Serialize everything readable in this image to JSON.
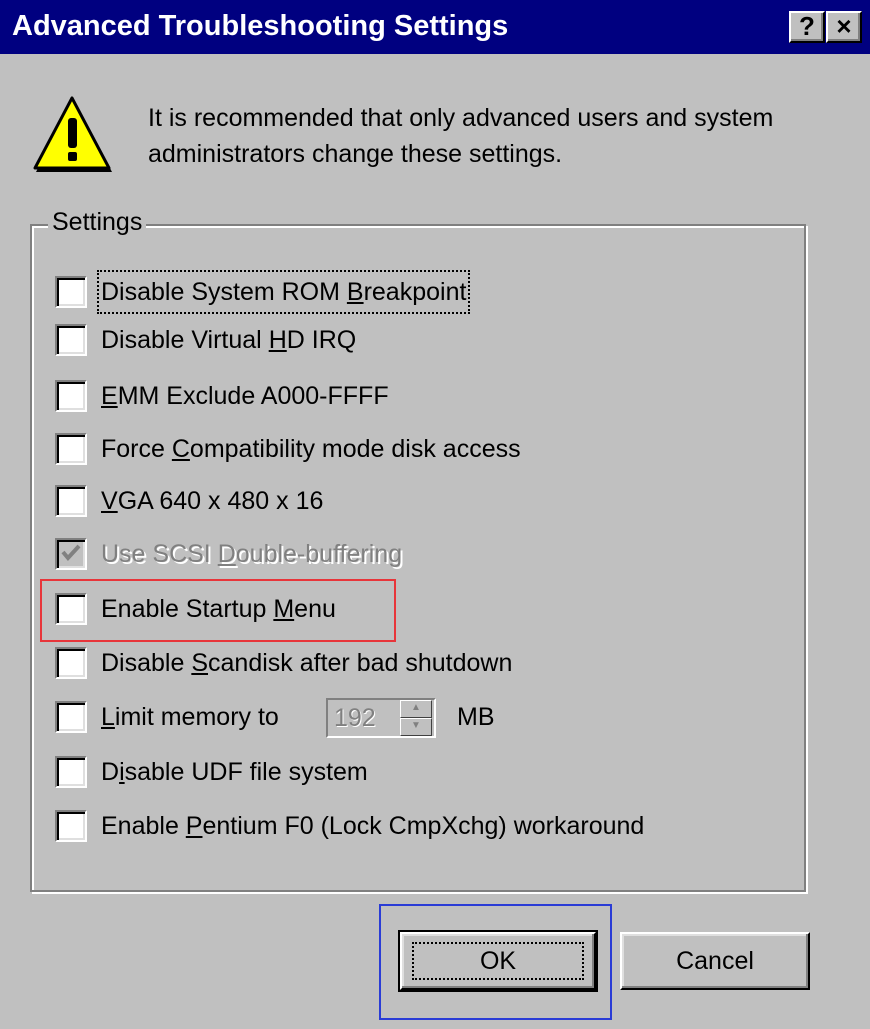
{
  "window": {
    "title": "Advanced Troubleshooting Settings",
    "help_label": "?",
    "close_label": "×"
  },
  "warning": {
    "icon": "warning-icon",
    "text": "It is recommended that only advanced users and system administrators change these settings."
  },
  "settings": {
    "legend": "Settings",
    "options": [
      {
        "pre": "Disable System ROM ",
        "key": "B",
        "post": "reakpoint",
        "checked": false,
        "disabled": false,
        "focused": true
      },
      {
        "pre": "Disable Virtual ",
        "key": "H",
        "post": "D IRQ",
        "checked": false,
        "disabled": false,
        "focused": false
      },
      {
        "pre": "",
        "key": "E",
        "post": "MM Exclude A000-FFFF",
        "checked": false,
        "disabled": false,
        "focused": false
      },
      {
        "pre": "Force ",
        "key": "C",
        "post": "ompatibility mode disk access",
        "checked": false,
        "disabled": false,
        "focused": false
      },
      {
        "pre": "",
        "key": "V",
        "post": "GA 640 x 480 x 16",
        "checked": false,
        "disabled": false,
        "focused": false
      },
      {
        "pre": "Use SCSI ",
        "key": "D",
        "post": "ouble-buffering",
        "checked": true,
        "disabled": true,
        "focused": false
      },
      {
        "pre": "Enable Startup ",
        "key": "M",
        "post": "enu",
        "checked": false,
        "disabled": false,
        "focused": false
      },
      {
        "pre": "Disable ",
        "key": "S",
        "post": "candisk after bad shutdown",
        "checked": false,
        "disabled": false,
        "focused": false
      },
      {
        "pre": "",
        "key": "L",
        "post": "imit memory to",
        "checked": false,
        "disabled": false,
        "focused": false
      },
      {
        "pre": "D",
        "key": "i",
        "post": "sable UDF file system",
        "checked": false,
        "disabled": false,
        "focused": false
      },
      {
        "pre": "Enable ",
        "key": "P",
        "post": "entium F0 (Lock CmpXchg) workaround",
        "checked": false,
        "disabled": false,
        "focused": false
      }
    ],
    "memory_limit": {
      "value": "192",
      "unit": "MB"
    }
  },
  "buttons": {
    "ok": "OK",
    "cancel": "Cancel"
  },
  "colors": {
    "title_bar": "#000080",
    "face": "#c0c0c0",
    "annotation_red": "#e8353a",
    "annotation_blue": "#2a3cd6"
  }
}
